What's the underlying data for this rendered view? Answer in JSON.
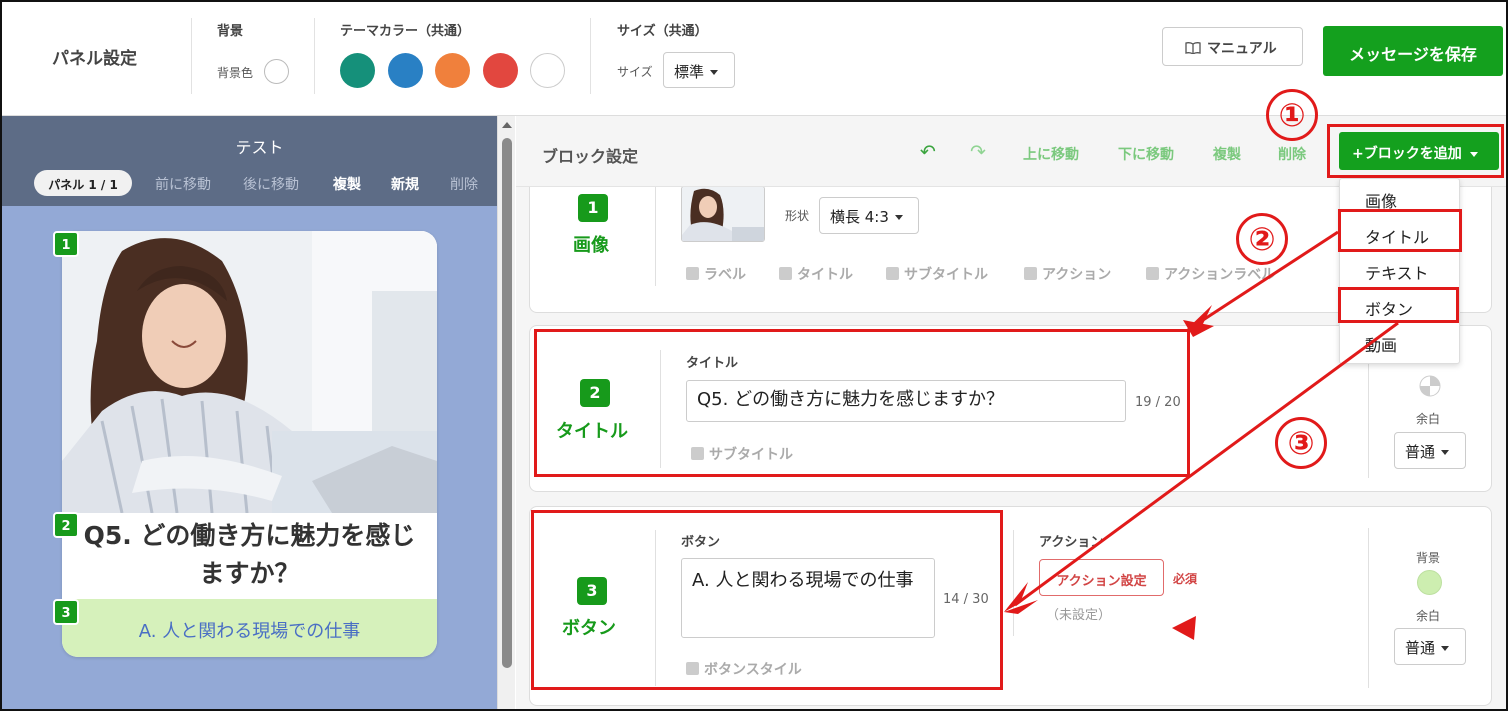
{
  "topbar": {
    "panel_settings": "パネル設定",
    "background_label": "背景",
    "background_color_label": "背景色",
    "theme_color_label": "テーマカラー（共通）",
    "theme_colors": [
      "#15907a",
      "#2980c4",
      "#f0803c",
      "#e2473f",
      "#ffffff"
    ],
    "size_label": "サイズ（共通）",
    "size_small": "サイズ",
    "size_value": "標準",
    "manual_button": "マニュアル",
    "save_button": "メッセージを保存"
  },
  "left": {
    "title": "テスト",
    "panel_pill": "パネル 1 / 1",
    "actions": [
      "前に移動",
      "後に移動",
      "複製",
      "新規",
      "削除"
    ],
    "card_title": "Q5. どの働き方に魅力を感じますか？",
    "card_button": "A. 人と関わる現場での仕事",
    "badges": [
      "1",
      "2",
      "3"
    ]
  },
  "editor": {
    "title": "ブロック設定",
    "undo_icon": "undo-icon",
    "redo_icon": "redo-icon",
    "move_up": "上に移動",
    "move_down": "下に移動",
    "duplicate": "複製",
    "delete": "削除",
    "add_block": "+ブロックを追加",
    "dropdown": [
      "画像",
      "タイトル",
      "テキスト",
      "ボタン",
      "動画"
    ],
    "blocks": [
      {
        "num": "1",
        "type": "画像",
        "shape_label": "形状",
        "shape_value": "横長 4:3",
        "options": [
          "ラベル",
          "タイトル",
          "サブタイトル",
          "アクション",
          "アクションラベル"
        ]
      },
      {
        "num": "2",
        "type": "タイトル",
        "field_label": "タイトル",
        "value": "Q5. どの働き方に魅力を感じますか？",
        "counter": "19 / 20",
        "option": "サブタイトル",
        "margin_label": "余白",
        "margin_value": "普通"
      },
      {
        "num": "3",
        "type": "ボタン",
        "field_label": "ボタン",
        "value": "A. 人と関わる現場での仕事",
        "counter": "14 / 30",
        "option": "ボタンスタイル",
        "action_label": "アクション",
        "action_button": "アクション設定",
        "required": "必須",
        "unset": "（未設定）",
        "bg_label": "背景",
        "bg_color": "#cdeeb0",
        "margin_label": "余白",
        "margin_value": "普通"
      }
    ]
  },
  "annotations": {
    "step1": "①",
    "step2": "②",
    "step3": "③",
    "color": "#e11a1a"
  }
}
